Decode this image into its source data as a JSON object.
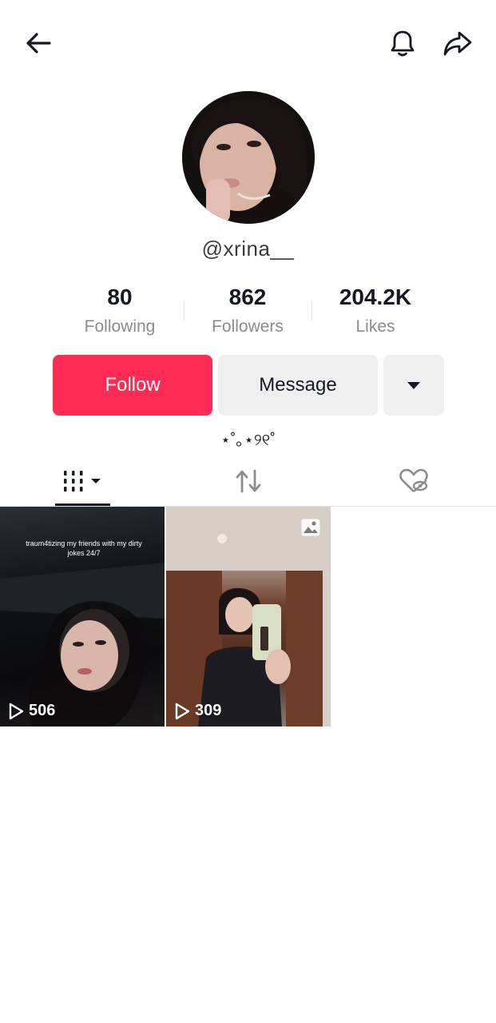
{
  "profile": {
    "username": "@xrina__",
    "bio": "⋆˚｡⋆୨୧˚"
  },
  "stats": {
    "following": {
      "value": "80",
      "label": "Following"
    },
    "followers": {
      "value": "862",
      "label": "Followers"
    },
    "likes": {
      "value": "204.2K",
      "label": "Likes"
    }
  },
  "actions": {
    "follow_label": "Follow",
    "message_label": "Message"
  },
  "colors": {
    "accent": "#fe2c55",
    "secondary_button": "#efeff0",
    "muted_text": "#8a8b91"
  },
  "icons": [
    "back-arrow-icon",
    "bell-icon",
    "share-icon",
    "chevron-down-icon",
    "grid-icon",
    "repost-icon",
    "liked-hidden-icon",
    "play-icon",
    "photo-icon"
  ],
  "videos": [
    {
      "views": "506",
      "caption": "traum4tizing my friends with my dirty jokes 24/7"
    },
    {
      "views": "309"
    }
  ]
}
